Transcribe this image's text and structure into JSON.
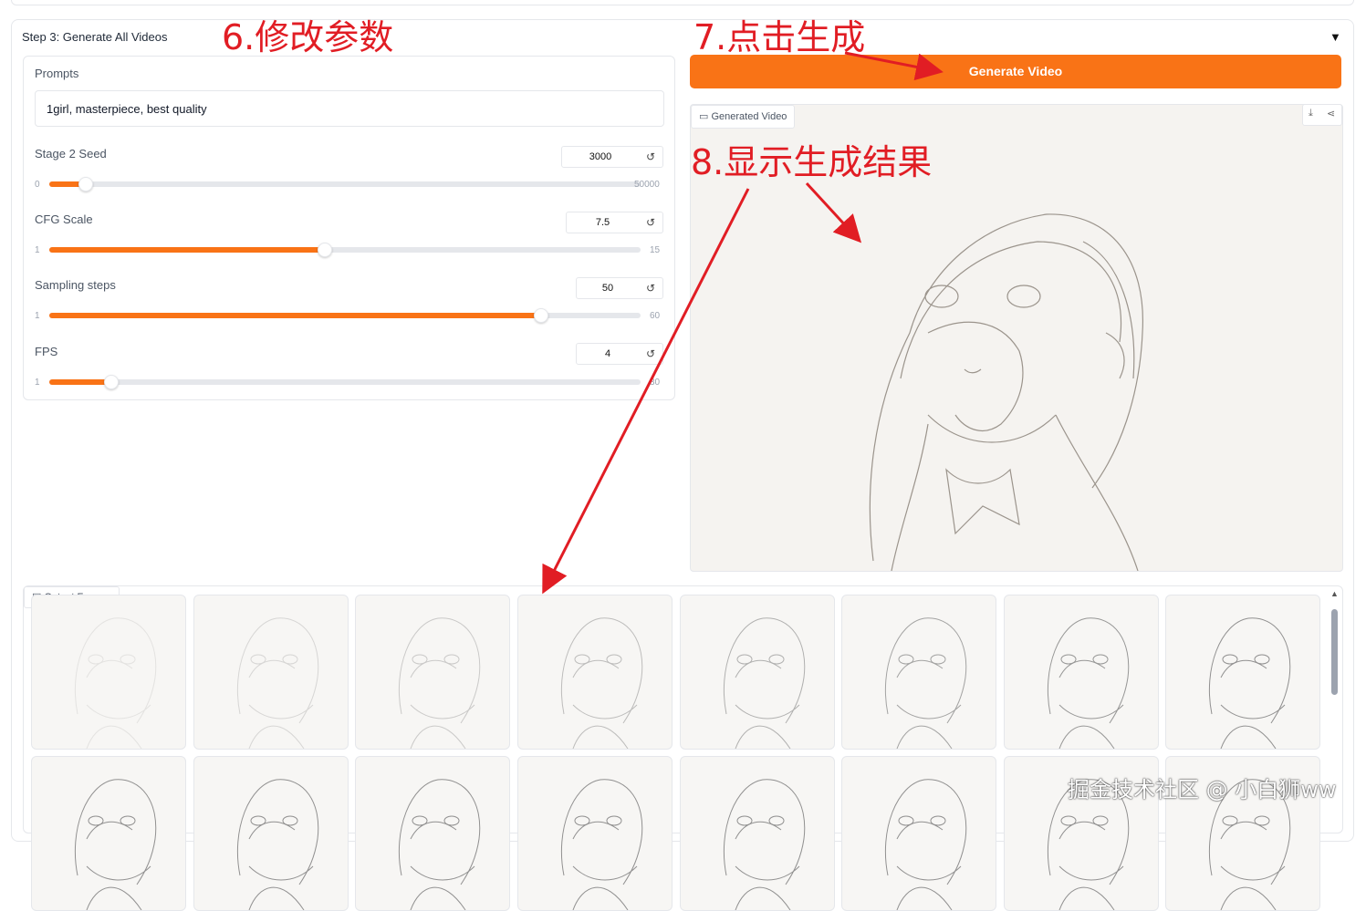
{
  "step": {
    "title": "Step 3: Generate All Videos",
    "collapse_icon": "▼"
  },
  "prompts": {
    "label": "Prompts",
    "value": "1girl, masterpiece, best quality"
  },
  "sliders": [
    {
      "label": "Stage 2 Seed",
      "value": "3000",
      "min": "0",
      "max": "50000",
      "fraction": 0.06
    },
    {
      "label": "CFG Scale",
      "value": "7.5",
      "min": "1",
      "max": "15",
      "fraction": 0.464
    },
    {
      "label": "Sampling steps",
      "value": "50",
      "min": "1",
      "max": "60",
      "fraction": 0.83
    },
    {
      "label": "FPS",
      "value": "4",
      "min": "1",
      "max": "30",
      "fraction": 0.103
    }
  ],
  "reset_icon": "↺",
  "generate_button": "Generate Video",
  "generated_video": {
    "label": "Generated Video"
  },
  "output_frames": {
    "label": "Output Frames"
  },
  "annotations": {
    "modify": "6.修改参数",
    "click": "7.点击生成",
    "result": "8.显示生成结果"
  },
  "watermark": "掘金技术社区 @ 小白狮ww",
  "colors": {
    "accent": "#f97316",
    "annotation": "#e11d24"
  }
}
